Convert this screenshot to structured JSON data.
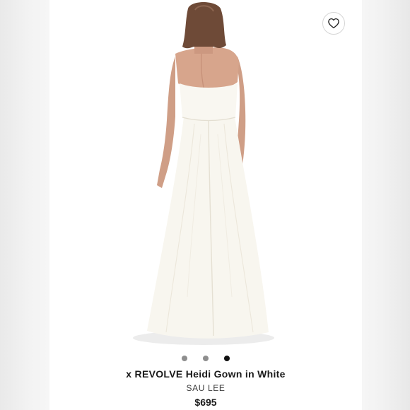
{
  "product": {
    "title": "x REVOLVE Heidi Gown in White",
    "brand": "SAU LEE",
    "price": "$695"
  },
  "gallery": {
    "image_count": 3,
    "active_index": 2
  },
  "icons": {
    "favorite": "heart-outline-icon"
  },
  "colors": {
    "dress": "#f8f6ef",
    "dot_inactive": "#8e8e8e",
    "dot_active": "#111111",
    "text": "#1a1a1a"
  }
}
